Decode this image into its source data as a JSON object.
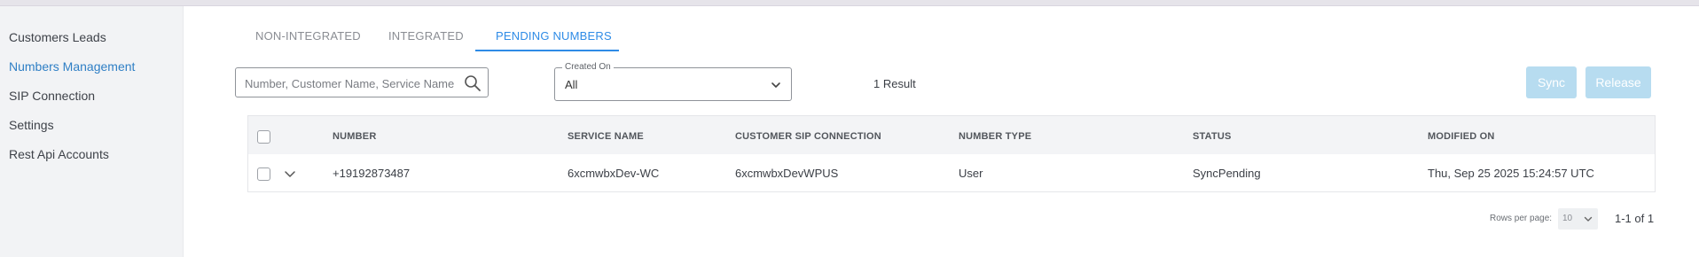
{
  "sidebar": {
    "items": [
      {
        "label": "Customers Leads"
      },
      {
        "label": "Numbers Management",
        "active": true
      },
      {
        "label": "SIP Connection"
      },
      {
        "label": "Settings"
      },
      {
        "label": "Rest Api Accounts"
      }
    ]
  },
  "tabs": [
    {
      "label": "NON-INTEGRATED"
    },
    {
      "label": "INTEGRATED"
    },
    {
      "label": "PENDING NUMBERS",
      "active": true
    }
  ],
  "search": {
    "placeholder": "Number, Customer Name, Service Name",
    "value": ""
  },
  "created_on": {
    "label": "Created On",
    "value": "All"
  },
  "results_text": "1 Result",
  "actions": {
    "sync_label": "Sync",
    "release_label": "Release"
  },
  "table": {
    "columns": [
      "NUMBER",
      "SERVICE NAME",
      "CUSTOMER SIP CONNECTION",
      "NUMBER TYPE",
      "STATUS",
      "MODIFIED ON"
    ],
    "rows": [
      {
        "number": "+19192873487",
        "service_name": "6xcmwbxDev-WC",
        "customer_sip_connection": "6xcmwbxDevWPUS",
        "number_type": "User",
        "status": "SyncPending",
        "modified_on": "Thu, Sep 25 2025 15:24:57 UTC"
      }
    ]
  },
  "pagination": {
    "rows_per_page_label": "Rows per page:",
    "rows_per_page": "10",
    "range": "1-1 of 1"
  },
  "colors": {
    "accent": "#2e8be6",
    "sidebar_bg": "#f2f3f5",
    "button_disabled": "#b7dcf0",
    "header_bg": "#f3f4f6"
  }
}
